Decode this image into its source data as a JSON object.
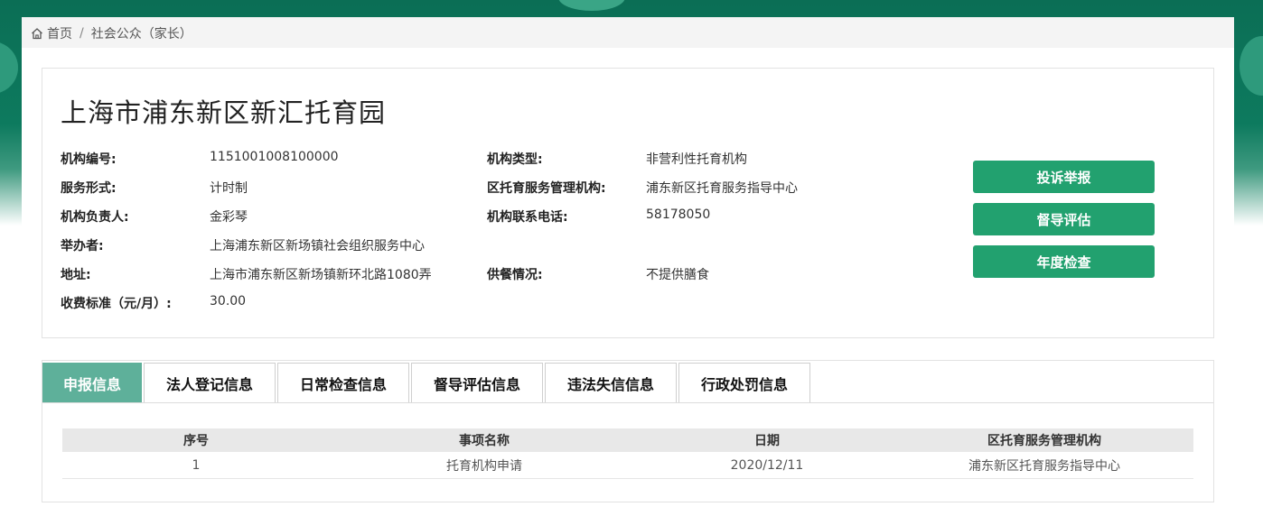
{
  "breadcrumb": {
    "home": "首页",
    "separator": "/",
    "current": "社会公众（家长）"
  },
  "org": {
    "name": "上海市浦东新区新汇托育园",
    "fields": [
      {
        "label": "机构编号:",
        "value": "1151001008100000"
      },
      {
        "label": "机构类型:",
        "value": "非营利性托育机构"
      },
      {
        "label": "服务形式:",
        "value": "计时制"
      },
      {
        "label": "区托育服务管理机构:",
        "value": "浦东新区托育服务指导中心"
      },
      {
        "label": "机构负责人:",
        "value": "金彩琴"
      },
      {
        "label": "机构联系电话:",
        "value": "58178050"
      },
      {
        "label": "举办者:",
        "value": "上海浦东新区新场镇社会组织服务中心"
      },
      {
        "label": "地址:",
        "value": "上海市浦东新区新场镇新环北路1080弄"
      },
      {
        "label": "供餐情况:",
        "value": "不提供膳食"
      },
      {
        "label": "收费标准（元/月）:",
        "value": "30.00"
      }
    ]
  },
  "actions": [
    {
      "label": "投诉举报"
    },
    {
      "label": "督导评估"
    },
    {
      "label": "年度检查"
    }
  ],
  "tabs": [
    {
      "label": "申报信息",
      "active": true
    },
    {
      "label": "法人登记信息",
      "active": false
    },
    {
      "label": "日常检查信息",
      "active": false
    },
    {
      "label": "督导评估信息",
      "active": false
    },
    {
      "label": "违法失信信息",
      "active": false
    },
    {
      "label": "行政处罚信息",
      "active": false
    }
  ],
  "table": {
    "headers": [
      "序号",
      "事项名称",
      "日期",
      "区托育服务管理机构"
    ],
    "rows": [
      [
        "1",
        "托育机构申请",
        "2020/12/11",
        "浦东新区托育服务指导中心"
      ]
    ]
  },
  "colors": {
    "brand_dark": "#0b6e55",
    "button": "#22a16f",
    "tab_active": "#5eb09a"
  },
  "icons": {
    "breadcrumb_home": "home-icon"
  }
}
